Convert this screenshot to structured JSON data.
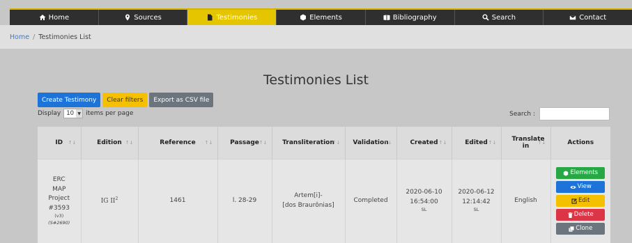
{
  "nav": [
    {
      "label": "Home",
      "icon": "home-icon"
    },
    {
      "label": "Sources",
      "icon": "map-marker-icon"
    },
    {
      "label": "Testimonies",
      "icon": "file-icon",
      "active": true
    },
    {
      "label": "Elements",
      "icon": "cube-icon"
    },
    {
      "label": "Bibliography",
      "icon": "book-icon"
    },
    {
      "label": "Search",
      "icon": "search-icon"
    },
    {
      "label": "Contact",
      "icon": "envelope-icon"
    }
  ],
  "breadcrumb": {
    "home": "Home",
    "sep": "/",
    "current": "Testimonies List"
  },
  "page_title": "Testimonies List",
  "toolbar": {
    "create": "Create Testimony",
    "clear": "Clear filters",
    "export": "Export as CSV file"
  },
  "display": {
    "prefix": "Display",
    "value": "10",
    "suffix": "items per page"
  },
  "search": {
    "label": "Search :",
    "value": ""
  },
  "table": {
    "headers": [
      "ID",
      "Edition",
      "Reference",
      "Passage",
      "Transliteration",
      "Validation",
      "Created",
      "Edited",
      "Translate in",
      "Actions"
    ],
    "row": {
      "id_lines": [
        "ERC",
        "MAP",
        "Project",
        "#3593"
      ],
      "id_version": "(v3)",
      "id_source": "(S#2690)",
      "edition": "IG II",
      "edition_sup": "2",
      "reference": "1461",
      "passage": "l. 28-29",
      "transliteration_1": "Artem[i]-",
      "transliteration_2": "[dos Braurônias]",
      "validation": "Completed",
      "created_date": "2020-06-10",
      "created_time": "16:54:00",
      "created_user": "SL",
      "edited_date": "2020-06-12",
      "edited_time": "12:14:42",
      "edited_user": "SL",
      "translate": "English"
    },
    "actions": [
      "Elements",
      "View",
      "Edit",
      "Delete",
      "Clone"
    ]
  },
  "colors": {
    "nav_bg": "#2f2f2f",
    "nav_active": "#e5c400",
    "primary": "#1e73d8",
    "warning": "#f5c000",
    "success": "#28a745",
    "danger": "#dc3545",
    "secondary": "#6c757d"
  }
}
